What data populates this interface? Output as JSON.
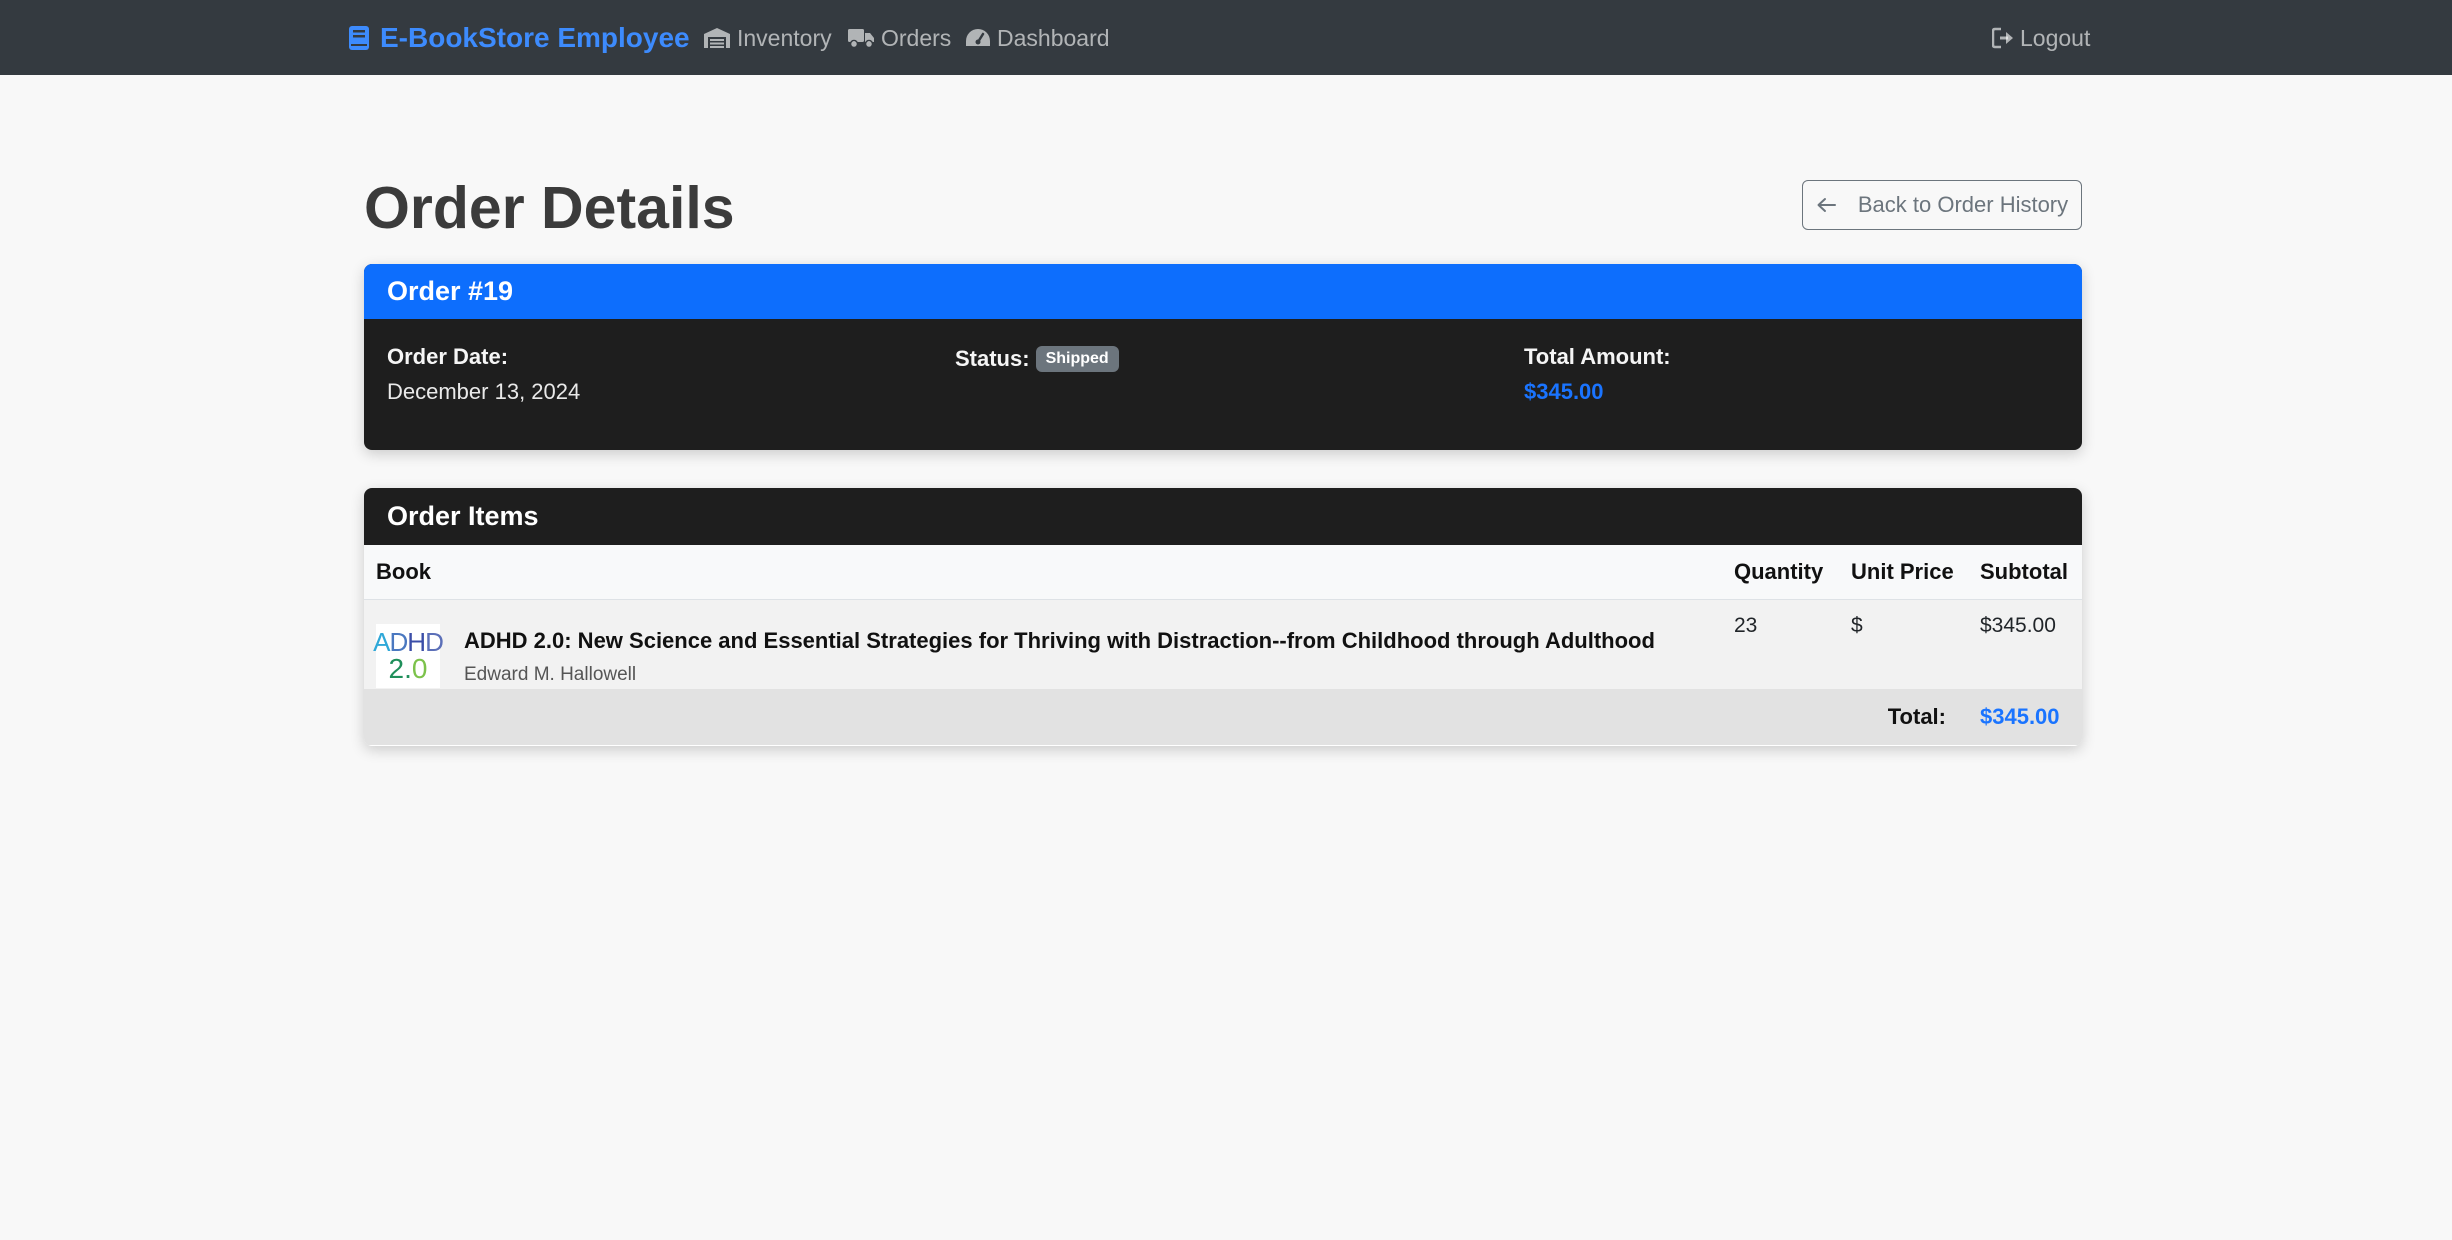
{
  "navbar": {
    "brand": "E-BookStore Employee",
    "links": [
      "Inventory",
      "Orders",
      "Dashboard"
    ],
    "logout": "Logout",
    "brand_color": "#3d8bfd"
  },
  "page": {
    "title": "Order Details",
    "back_button": "Back to Order History"
  },
  "order": {
    "header": "Order #19",
    "date_label": "Order Date:",
    "date_value": "December 13, 2024",
    "status_label": "Status:",
    "status_value": "Shipped",
    "total_label": "Total Amount:",
    "total_value": "$345.00"
  },
  "items": {
    "header": "Order Items",
    "columns": [
      "Book",
      "Quantity",
      "Unit Price",
      "Subtotal"
    ],
    "rows": [
      {
        "title": "ADHD 2.0: New Science and Essential Strategies for Thriving with Distraction--from Childhood through Adulthood",
        "author": "Edward M. Hallowell",
        "cover_line1": "ADHD",
        "cover_line2": "2.0",
        "quantity": "23",
        "unit_price": "$",
        "subtotal": "$345.00"
      }
    ],
    "total_label": "Total:",
    "total_value": "$345.00"
  }
}
